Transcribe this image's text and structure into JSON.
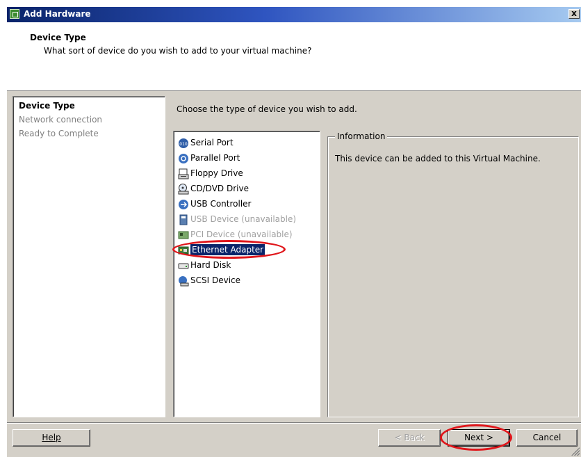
{
  "window": {
    "title": "Add Hardware",
    "app_icon": "vm-hardware-icon",
    "close_label": "x"
  },
  "header": {
    "title": "Device Type",
    "subtitle": "What sort of device do you wish to add to your virtual machine?"
  },
  "steps": [
    {
      "label": "Device Type",
      "state": "active"
    },
    {
      "label": "Network connection",
      "state": "pending"
    },
    {
      "label": "Ready to Complete",
      "state": "pending"
    }
  ],
  "main": {
    "prompt": "Choose the type of device you wish to add.",
    "devices": [
      {
        "label": "Serial Port",
        "icon": "serial-port-icon",
        "available": true,
        "selected": false
      },
      {
        "label": "Parallel Port",
        "icon": "parallel-port-icon",
        "available": true,
        "selected": false
      },
      {
        "label": "Floppy Drive",
        "icon": "floppy-drive-icon",
        "available": true,
        "selected": false
      },
      {
        "label": "CD/DVD Drive",
        "icon": "cd-dvd-drive-icon",
        "available": true,
        "selected": false
      },
      {
        "label": "USB Controller",
        "icon": "usb-controller-icon",
        "available": true,
        "selected": false
      },
      {
        "label": "USB Device (unavailable)",
        "icon": "usb-device-icon",
        "available": false,
        "selected": false
      },
      {
        "label": "PCI Device (unavailable)",
        "icon": "pci-device-icon",
        "available": false,
        "selected": false
      },
      {
        "label": "Ethernet Adapter",
        "icon": "ethernet-adapter-icon",
        "available": true,
        "selected": true
      },
      {
        "label": "Hard Disk",
        "icon": "hard-disk-icon",
        "available": true,
        "selected": false
      },
      {
        "label": "SCSI Device",
        "icon": "scsi-device-icon",
        "available": true,
        "selected": false
      }
    ],
    "info": {
      "legend": "Information",
      "text": "This device can be added to this Virtual Machine."
    }
  },
  "buttons": {
    "help": "Help",
    "back": "< Back",
    "next": "Next >",
    "cancel": "Cancel"
  },
  "colors": {
    "selection": "#0a246a",
    "annotation": "#e0161b",
    "face": "#d4d0c8"
  }
}
